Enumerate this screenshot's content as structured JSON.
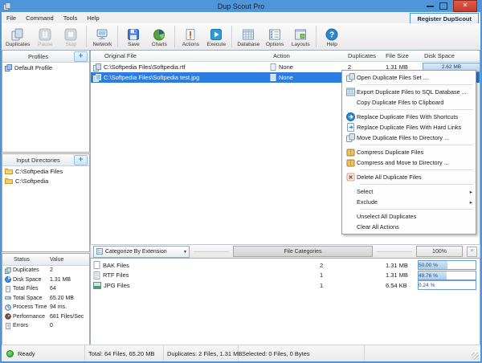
{
  "window": {
    "title": "Dup Scout Pro",
    "controls": {
      "minimize": "minimize-icon",
      "maximize": "maximize-icon",
      "close_glyph": "✕"
    }
  },
  "menubar": {
    "items": [
      "File",
      "Command",
      "Tools",
      "Help"
    ],
    "register_button_label": "Register DupScout"
  },
  "toolbar": {
    "buttons": [
      {
        "label": "Duplicates",
        "icon": "duplicates-icon",
        "enabled": true
      },
      {
        "label": "Pause",
        "icon": "pause-icon",
        "enabled": false
      },
      {
        "label": "Stop",
        "icon": "stop-icon",
        "enabled": false
      },
      {
        "label": "Network",
        "icon": "network-icon",
        "enabled": true
      },
      {
        "label": "Save",
        "icon": "save-icon",
        "enabled": true
      },
      {
        "label": "Charts",
        "icon": "charts-icon",
        "enabled": true
      },
      {
        "label": "Actions",
        "icon": "actions-icon",
        "enabled": true
      },
      {
        "label": "Execute",
        "icon": "execute-icon",
        "enabled": true
      },
      {
        "label": "Database",
        "icon": "database-icon",
        "enabled": true
      },
      {
        "label": "Options",
        "icon": "options-icon",
        "enabled": true
      },
      {
        "label": "Layouts",
        "icon": "layouts-icon",
        "enabled": true
      },
      {
        "label": "Help",
        "icon": "help-icon",
        "enabled": true
      }
    ]
  },
  "profiles_panel": {
    "title": "Profiles",
    "add_button_glyph": "+",
    "items": [
      {
        "label": "Default Profile",
        "icon": "profile-icon"
      }
    ]
  },
  "input_directories_panel": {
    "title": "Input Directories",
    "add_button_glyph": "+",
    "items": [
      {
        "label": "C:\\Softpedia Files",
        "icon": "folder-icon"
      },
      {
        "label": "C:\\Softpedia",
        "icon": "folder-icon"
      }
    ]
  },
  "status_panel": {
    "columns": {
      "status": "Status",
      "value": "Value"
    },
    "rows": [
      {
        "icon": "duplicates-icon",
        "label": "Duplicates",
        "value": "2"
      },
      {
        "icon": "disk-space-icon",
        "label": "Disk Space",
        "value": "1.31 MB"
      },
      {
        "icon": "total-files-icon",
        "label": "Total Files",
        "value": "64"
      },
      {
        "icon": "total-space-icon",
        "label": "Total Space",
        "value": "65.20 MB"
      },
      {
        "icon": "process-time-icon",
        "label": "Process Time",
        "value": "94 ms."
      },
      {
        "icon": "performance-icon",
        "label": "Performance",
        "value": "681 Files/Sec"
      },
      {
        "icon": "errors-icon",
        "label": "Errors",
        "value": "0"
      }
    ]
  },
  "file_list": {
    "columns": [
      "Original File",
      "Action",
      "Duplicates",
      "File Size",
      "Disk Space"
    ],
    "rows": [
      {
        "file": "C:\\Softpedia Files\\Softpedia.rtf",
        "action": "None",
        "duplicates": "2",
        "file_size": "1.31 MB",
        "disk_space": "2.62 MB",
        "selected": false
      },
      {
        "file": "C:\\Softpedia Files\\Softpedia test.jpg",
        "action": "None",
        "duplicates": "",
        "file_size": "",
        "disk_space": "",
        "selected": true
      }
    ]
  },
  "context_menu": {
    "items": [
      {
        "label": "Open Duplicate Files Set ...",
        "icon": "open-set-icon"
      },
      {
        "label": "Export Duplicate Files to SQL Database ...",
        "icon": "sql-database-icon"
      },
      {
        "label": "Copy Duplicate Files to Clipboard",
        "icon": ""
      },
      {
        "label": "Replace Duplicate Files With Shortcuts",
        "icon": "shortcut-icon"
      },
      {
        "label": "Replace Duplicate Files With Hard Links",
        "icon": "hard-link-icon"
      },
      {
        "label": "Move Duplicate Files to Directory ...",
        "icon": "move-icon"
      },
      {
        "label": "Compress Duplicate Files",
        "icon": "compress-icon"
      },
      {
        "label": "Compress and Move to Directory ...",
        "icon": "compress-icon"
      },
      {
        "label": "Delete All Duplicate Files",
        "icon": "delete-icon"
      },
      {
        "label": "Select",
        "icon": "",
        "submenu": true
      },
      {
        "label": "Exclude",
        "icon": "",
        "submenu": true
      },
      {
        "label": "Unselect All Duplicates",
        "icon": ""
      },
      {
        "label": "Clear All Actions",
        "icon": ""
      }
    ],
    "submenu_arrow": "▸"
  },
  "categories_panel": {
    "dropdown_label": "Categorize By Extension",
    "dropdown_caret": "▾",
    "center_button_label": "File Categories",
    "zoom_button_label": "100%",
    "close_button_glyph": "×",
    "rows": [
      {
        "icon": "bak-file-icon",
        "label": "BAK Files",
        "count": "2",
        "size": "1.31 MB",
        "percent_label": "50.00 %",
        "percent": 50
      },
      {
        "icon": "rtf-file-icon",
        "label": "RTF Files",
        "count": "1",
        "size": "1.31 MB",
        "percent_label": "49.76 %",
        "percent": 49.76
      },
      {
        "icon": "jpg-file-icon",
        "label": "JPG Files",
        "count": "1",
        "size": "6.54 KB",
        "percent_label": "0.24 %",
        "percent": 0.24
      }
    ]
  },
  "status_bar": {
    "state": "Ready",
    "total": "Total: 64 Files, 65.20 MB",
    "duplicates": "Duplicates: 2 Files, 1.31 MB",
    "selected": "Selected: 0 Files, 0 Bytes"
  },
  "colors": {
    "frame_blue": "#4f95da",
    "selection_blue": "#2b7de3",
    "close_red": "#c33b2c",
    "ready_green": "#2f9e2f"
  }
}
